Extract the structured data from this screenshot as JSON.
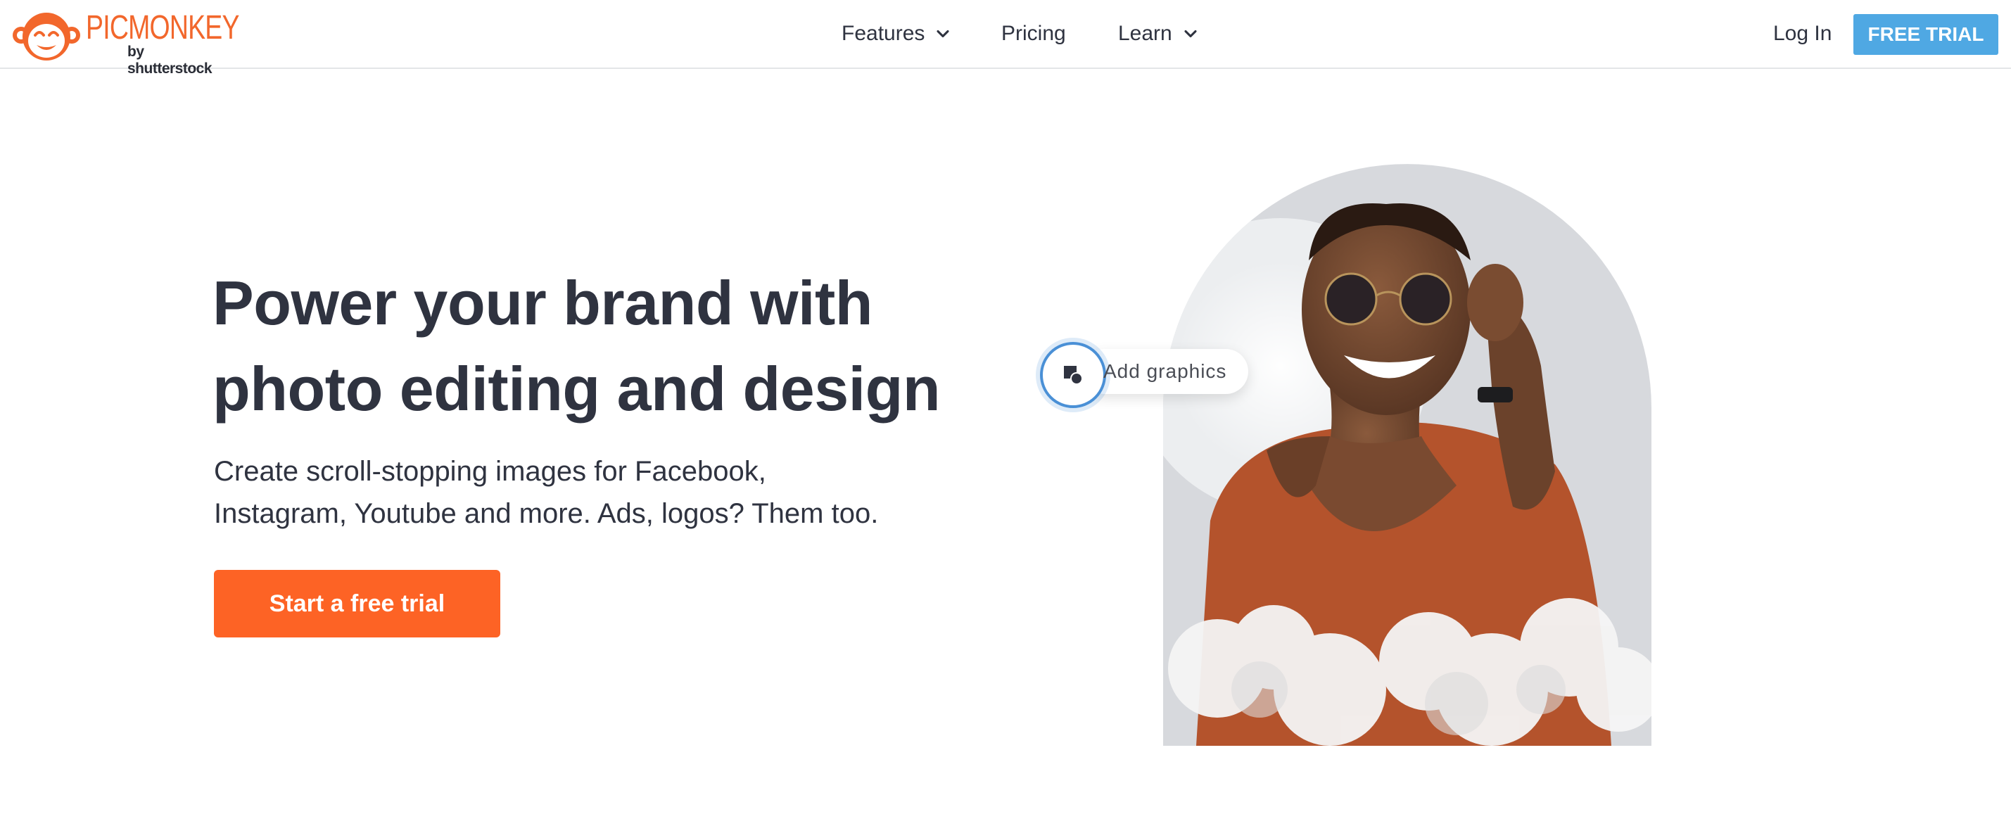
{
  "brand": {
    "name": "PICMONKEY",
    "sub": "by shutterstock",
    "color": "#f2672c"
  },
  "nav": {
    "features": "Features",
    "pricing": "Pricing",
    "learn": "Learn"
  },
  "header": {
    "login": "Log In",
    "free_trial": "FREE TRIAL",
    "free_trial_color": "#4fa8e3"
  },
  "hero": {
    "title_line1": "Power your brand with",
    "title_line2": "photo editing and design",
    "subtitle_line1": "Create scroll-stopping images for Facebook,",
    "subtitle_line2": "Instagram, Youtube and more. Ads, logos? Them too.",
    "cta": "Start a free trial",
    "cta_color": "#fd6325"
  },
  "visual": {
    "badge_label": "Add graphics",
    "badge_icon": "shapes-icon"
  }
}
